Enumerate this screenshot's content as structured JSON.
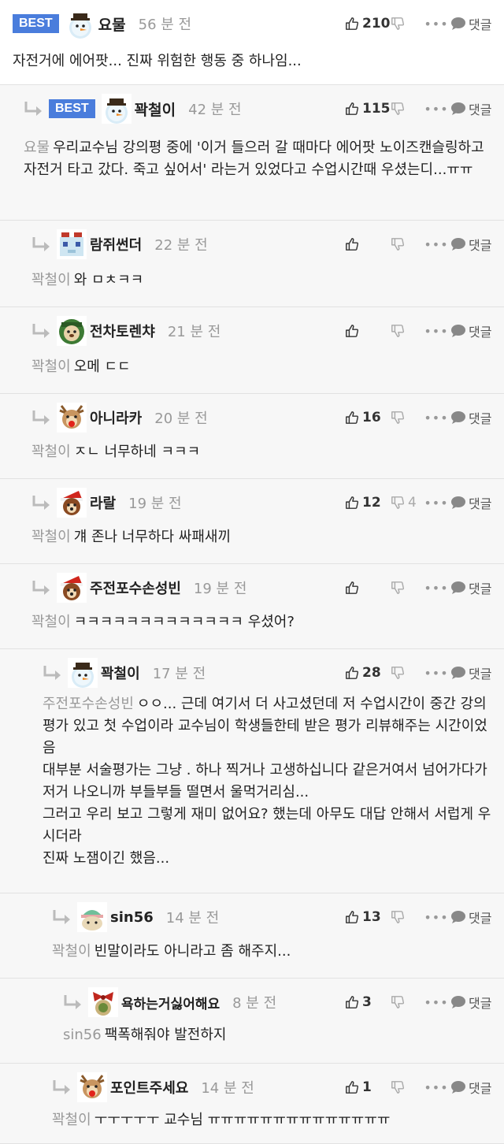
{
  "best_label": "BEST",
  "reply_label": "댓글",
  "more_label": "•••",
  "comments": [
    {
      "nick": "요물",
      "time": "56 분 전",
      "up": "210",
      "down": "",
      "best": true,
      "target": "",
      "body": "자전거에 에어팟... 진짜 위험한 행동 중 하나임..."
    },
    {
      "nick": "꽉철이",
      "time": "42 분 전",
      "up": "115",
      "down": "",
      "best": true,
      "target": "요물",
      "body": "우리교수님 강의평 중에 '이거 들으러 갈 때마다 에어팟 노이즈캔슬링하고 자전거 타고 갔다. 죽고 싶어서' 라는거 있었다고 수업시간때 우셨는디...ㅠㅠ"
    },
    {
      "nick": "람쥐썬더",
      "time": "22 분 전",
      "up": "",
      "down": "",
      "best": false,
      "target": "꽉철이",
      "body": "와 ㅁㅊㅋㅋ"
    },
    {
      "nick": "전차토렌챠",
      "time": "21 분 전",
      "up": "",
      "down": "",
      "best": false,
      "target": "꽉철이",
      "body": "오메 ㄷㄷ"
    },
    {
      "nick": "아니라카",
      "time": "20 분 전",
      "up": "16",
      "down": "",
      "best": false,
      "target": "꽉철이",
      "body": "ㅈㄴ 너무하네 ㅋㅋㅋ"
    },
    {
      "nick": "라랄",
      "time": "19 분 전",
      "up": "12",
      "down": "4",
      "best": false,
      "target": "꽉철이",
      "body": "걔 존나 너무하다 싸패새끼"
    },
    {
      "nick": "주전포수손성빈",
      "time": "19 분 전",
      "up": "",
      "down": "",
      "best": false,
      "target": "꽉철이",
      "body": "ㅋㅋㅋㅋㅋㅋㅋㅋㅋㅋㅋㅋㅋ 우셨어?"
    },
    {
      "nick": "꽉철이",
      "time": "17 분 전",
      "up": "28",
      "down": "",
      "best": false,
      "target": "주전포수손성빈",
      "body": "ㅇㅇ... 근데 여기서 더 사고셨던데 저 수업시간이 중간 강의평가 있고 첫 수업이라 교수님이 학생들한테 받은 평가 리뷰해주는 시간이었음\n대부분 서술평가는 그냥 . 하나 찍거나 고생하십니다 같은거여서 넘어가다가 저거 나오니까 부들부들 떨면서 울먹거리심...\n그러고 우리 보고 그렇게 재미 없어요? 했는데 아무도 대답 안해서 서럽게 우시더라\n진짜 노잼이긴 했음..."
    },
    {
      "nick": "sin56",
      "time": "14 분 전",
      "up": "13",
      "down": "",
      "best": false,
      "target": "꽉철이",
      "body": "빈말이라도 아니라고 좀 해주지..."
    },
    {
      "nick": "욕하는거싫어해요",
      "time": "8 분 전",
      "up": "3",
      "down": "",
      "best": false,
      "target": "sin56",
      "body": "팩폭해줘야 발전하지"
    },
    {
      "nick": "포인트주세요",
      "time": "14 분 전",
      "up": "1",
      "down": "",
      "best": false,
      "target": "꽉철이",
      "body": "ㅜㅜㅜㅜㅜ 교수님 ㅠㅠㅠㅠㅠㅠㅠㅠㅠㅠㅠㅠㅠㅠ"
    }
  ]
}
